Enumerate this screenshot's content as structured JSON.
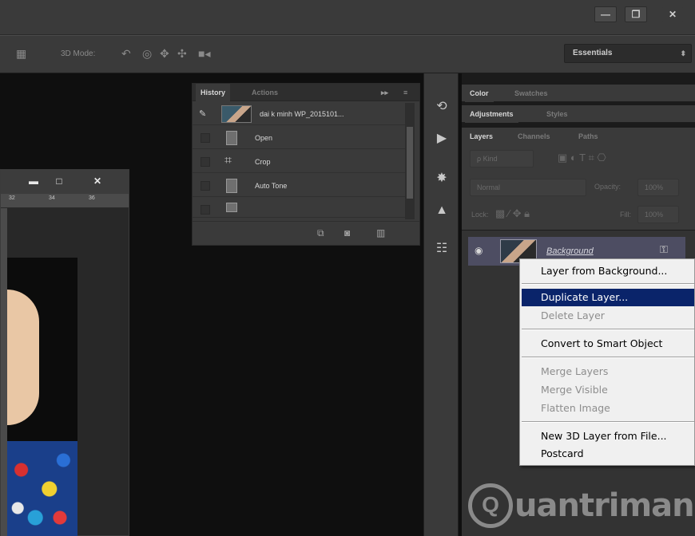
{
  "window": {
    "minimize_glyph": "—",
    "restore_glyph": "❐",
    "close_glyph": "✕"
  },
  "options_bar": {
    "mode_label": "3D Mode:",
    "workspace": "Essentials",
    "workspace_arrow": "⬍"
  },
  "document": {
    "ruler_ticks": [
      "32",
      "34",
      "36"
    ],
    "minimize_glyph": "▬",
    "maximize_glyph": "□",
    "close_glyph": "✕"
  },
  "history_panel": {
    "tabs": [
      "History",
      "Actions"
    ],
    "snapshot_label": "dai k minh WP_2015101...",
    "steps": [
      "Open",
      "Crop",
      "Auto Tone"
    ]
  },
  "right_panels": {
    "color_tabs": [
      "Color",
      "Swatches"
    ],
    "adjust_tabs": [
      "Adjustments",
      "Styles"
    ],
    "layers_tabs": [
      "Layers",
      "Channels",
      "Paths"
    ],
    "filter_kind": "ρ Kind",
    "blend_mode": "Normal",
    "opacity_label": "Opacity:",
    "opacity_value": "100%",
    "lock_label": "Lock:",
    "fill_label": "Fill:",
    "fill_value": "100%",
    "layer_name": "Background"
  },
  "context_menu": {
    "items": [
      {
        "label": "Layer from Background...",
        "enabled": true
      },
      {
        "label": "Duplicate Layer...",
        "enabled": true,
        "highlighted": true
      },
      {
        "label": "Delete Layer",
        "enabled": false
      },
      {
        "label": "Convert to Smart Object",
        "enabled": true
      },
      {
        "label": "Merge Layers",
        "enabled": false
      },
      {
        "label": "Merge Visible",
        "enabled": false
      },
      {
        "label": "Flatten Image",
        "enabled": false
      },
      {
        "label": "New 3D Layer from File...",
        "enabled": true
      },
      {
        "label": "Postcard",
        "enabled": true
      }
    ]
  },
  "watermark": {
    "text": "uantrimang",
    "icon": "Q"
  },
  "colors": {
    "menu_highlight": "#0a246a",
    "layer_selected": "#4d4d62",
    "panel_bg": "#3a3a3a"
  }
}
